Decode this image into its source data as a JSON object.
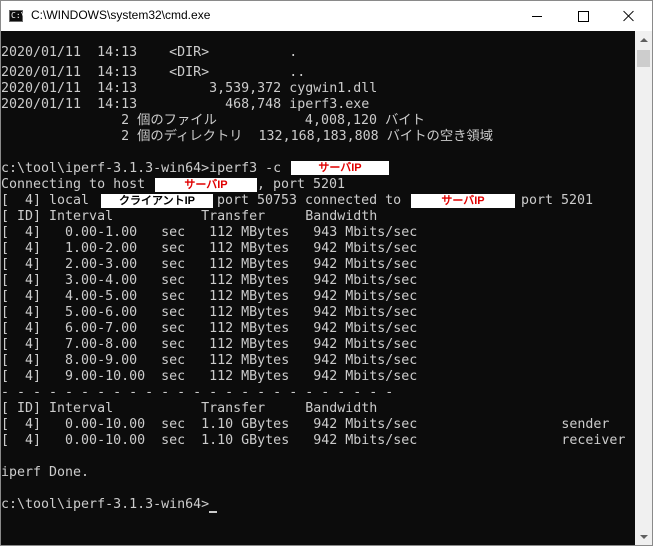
{
  "window": {
    "title": "C:\\WINDOWS\\system32\\cmd.exe"
  },
  "icons": {
    "app": "cmd-icon",
    "app_glyph": "C:\\",
    "minimize": "minimize-icon",
    "maximize": "maximize-icon",
    "close": "close-icon"
  },
  "console": {
    "dir_rows": [
      "2020/01/11  14:13    <DIR>          .",
      "2020/01/11  14:13    <DIR>          ..",
      "2020/01/11  14:13         3,539,372 cygwin1.dll",
      "2020/01/11  14:13           468,748 iperf3.exe"
    ],
    "summary": [
      "               2 個のファイル           4,008,120 バイト",
      "               2 個のディレクトリ  132,168,183,808 バイトの空き領域"
    ],
    "cmd_line": "c:\\tool\\iperf-3.1.3-win64>iperf3 -c",
    "connecting_prefix": "Connecting to host",
    "connecting_suffix": ", port 5201",
    "local_prefix": "[  4] local",
    "local_mid": "port 50753 connected to",
    "local_suffix": "port 5201",
    "server_ip_label": "サーバIP",
    "client_ip_label": "クライアントIP",
    "table_header": "[ ID] Interval           Transfer     Bandwidth",
    "interval_rows": [
      "[  4]   0.00-1.00   sec   112 MBytes   943 Mbits/sec",
      "[  4]   1.00-2.00   sec   112 MBytes   942 Mbits/sec",
      "[  4]   2.00-3.00   sec   112 MBytes   942 Mbits/sec",
      "[  4]   3.00-4.00   sec   112 MBytes   942 Mbits/sec",
      "[  4]   4.00-5.00   sec   112 MBytes   942 Mbits/sec",
      "[  4]   5.00-6.00   sec   112 MBytes   942 Mbits/sec",
      "[  4]   6.00-7.00   sec   112 MBytes   942 Mbits/sec",
      "[  4]   7.00-8.00   sec   112 MBytes   942 Mbits/sec",
      "[  4]   8.00-9.00   sec   112 MBytes   942 Mbits/sec",
      "[  4]   9.00-10.00  sec   112 MBytes   942 Mbits/sec"
    ],
    "separator": "- - - - - - - - - - - - - - - - - - - - - - - - -",
    "summary_header": "[ ID] Interval           Transfer     Bandwidth",
    "summary_rows": [
      "[  4]   0.00-10.00  sec  1.10 GBytes   942 Mbits/sec                  sender",
      "[  4]   0.00-10.00  sec  1.10 GBytes   942 Mbits/sec                  receiver"
    ],
    "done": "iperf Done.",
    "prompt": "c:\\tool\\iperf-3.1.3-win64>"
  }
}
